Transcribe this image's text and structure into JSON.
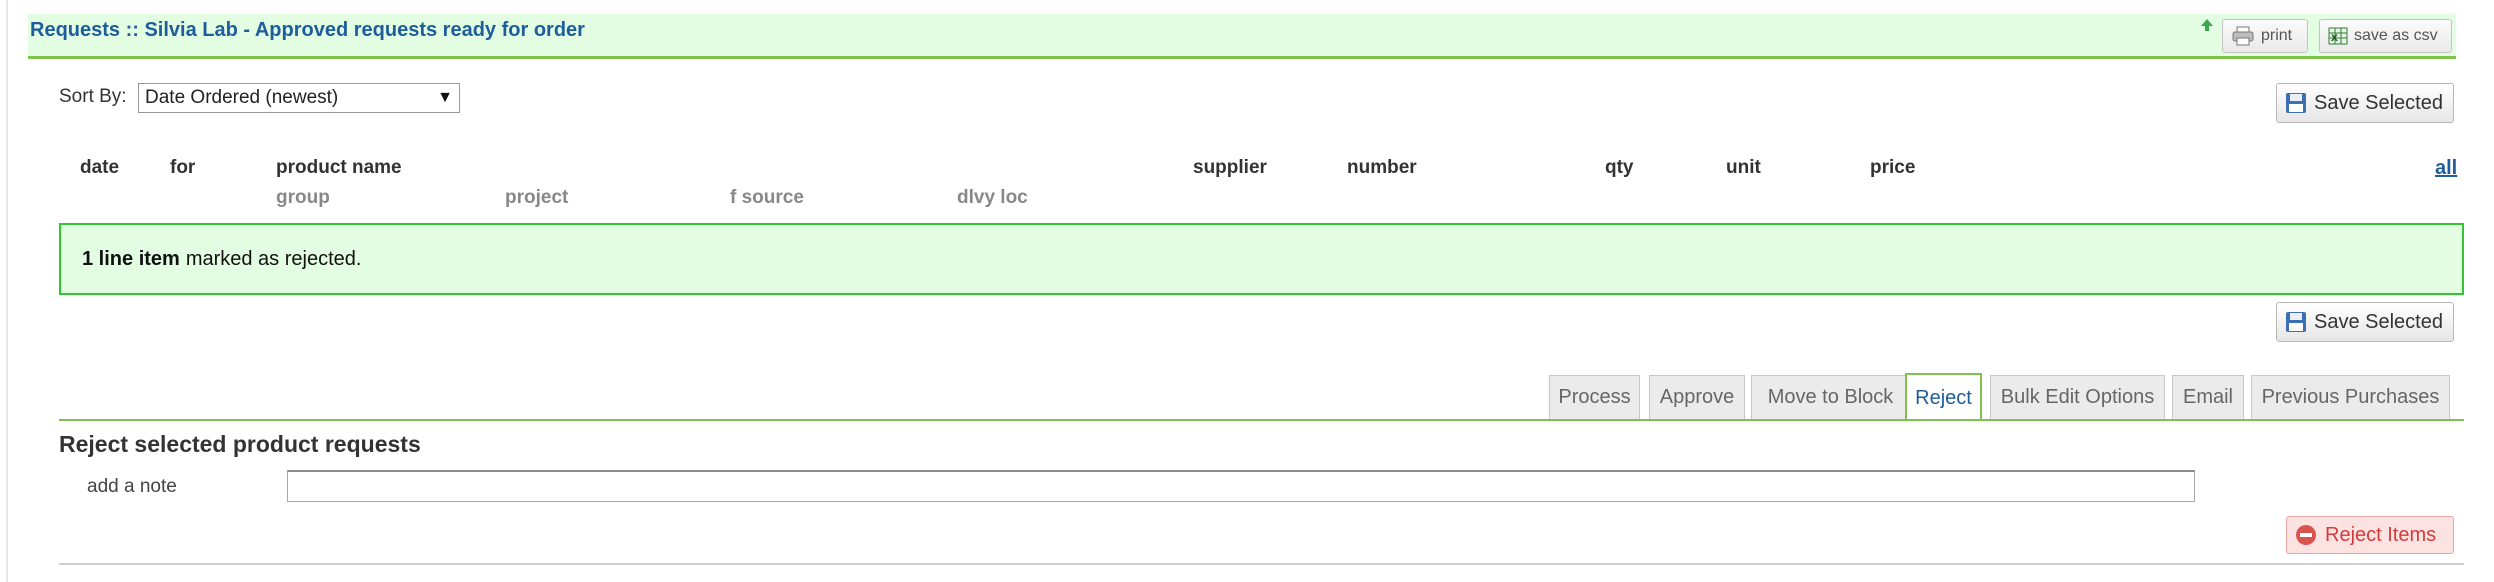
{
  "header": {
    "title": "Requests :: Silvia Lab - Approved requests ready for order",
    "print_label": "print",
    "csv_label": "save as csv"
  },
  "sort": {
    "label": "Sort By:",
    "selected": "Date Ordered (newest)"
  },
  "save_selected_label": "Save Selected",
  "table": {
    "columns_row1": [
      "date",
      "for",
      "product name",
      "supplier",
      "number",
      "qty",
      "unit",
      "price"
    ],
    "columns_row2": [
      "group",
      "project",
      "f source",
      "dlvy loc"
    ],
    "all_link": "all"
  },
  "notice": {
    "count_text": "1 line item",
    "message": "marked as rejected."
  },
  "tabs": [
    {
      "label": "Process",
      "active": false
    },
    {
      "label": "Approve",
      "active": false
    },
    {
      "label": "Move to Block",
      "active": false
    },
    {
      "label": "Reject",
      "active": true
    },
    {
      "label": "Bulk Edit Options",
      "active": false
    },
    {
      "label": "Email",
      "active": false
    },
    {
      "label": "Previous Purchases",
      "active": false
    }
  ],
  "reject_panel": {
    "title": "Reject selected product requests",
    "note_label": "add a note",
    "note_value": "",
    "button_label": "Reject Items"
  },
  "colors": {
    "accent_green": "#7fc34a",
    "header_bg": "#e3fde3",
    "link_blue": "#1e5d9b",
    "reject_red": "#d33b3b"
  }
}
